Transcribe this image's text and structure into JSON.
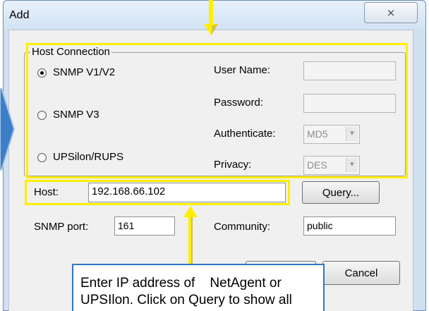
{
  "dialog": {
    "title": "Add",
    "close_glyph": "⨯"
  },
  "group": {
    "title": "Host Connection",
    "options": [
      {
        "label": "SNMP V1/V2",
        "selected": true
      },
      {
        "label": "SNMP V3",
        "selected": false
      },
      {
        "label": "UPSilon/RUPS",
        "selected": false
      }
    ],
    "user_name_label": "User Name:",
    "password_label": "Password:",
    "authenticate_label": "Authenticate:",
    "authenticate_value": "MD5",
    "privacy_label": "Privacy:",
    "privacy_value": "DES"
  },
  "host": {
    "label": "Host:",
    "value": "192.168.66.102",
    "query_button": "Query..."
  },
  "snmp": {
    "port_label": "SNMP port:",
    "port_value": "161",
    "community_label": "Community:",
    "community_value": "public"
  },
  "buttons": {
    "cancel": "Cancel"
  },
  "callout": {
    "line1": "Enter IP address of    NetAgent or",
    "line2": "UPSIlon. Click on Query to show all"
  },
  "colors": {
    "highlight": "#ffee00",
    "callout_border": "#2e78c2",
    "arrow_blue": "#3c7ec8"
  }
}
